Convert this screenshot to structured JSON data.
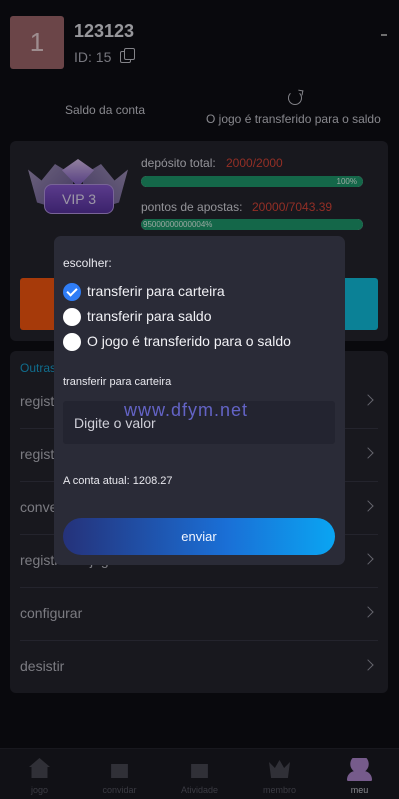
{
  "profile": {
    "avatar_letter": "1",
    "username": "123123",
    "id_text": "ID: 15"
  },
  "balance": {
    "label": "Saldo da conta",
    "transfer_status": "O jogo é transferido para o saldo"
  },
  "vip": {
    "level": "VIP 3",
    "deposit_label": "depósito total:",
    "deposit_value": "2000/2000",
    "deposit_percent_text": "100%",
    "deposit_progress": 1.0,
    "bets_label": "pontos de apostas:",
    "bets_value": "20000/7043.39",
    "bets_percent_text": "95000000000004%",
    "bets_progress": 1.0
  },
  "menu": {
    "title": "Outras",
    "items": [
      "regist",
      "regist",
      "conve",
      "registro do jogo",
      "configurar",
      "desistir"
    ]
  },
  "dialog": {
    "choose_label": "escolher:",
    "options": [
      {
        "label": "transferir para carteira",
        "checked": true
      },
      {
        "label": "transferir para saldo",
        "checked": false
      },
      {
        "label": "O jogo é transferido para o saldo",
        "checked": false
      }
    ],
    "section_title": "transferir para carteira",
    "input_placeholder": "Digite o valor",
    "watermark": "www.dfym.net",
    "current_balance": "A conta atual: 1208.27",
    "submit_label": "enviar"
  },
  "nav": {
    "items": [
      {
        "label": "jogo",
        "icon": "home-icon"
      },
      {
        "label": "convidar",
        "icon": "gift-icon"
      },
      {
        "label": "Atividade",
        "icon": "gift-icon"
      },
      {
        "label": "membro",
        "icon": "crown-icon"
      },
      {
        "label": "meu",
        "icon": "user-icon"
      }
    ],
    "active_index": 4
  }
}
